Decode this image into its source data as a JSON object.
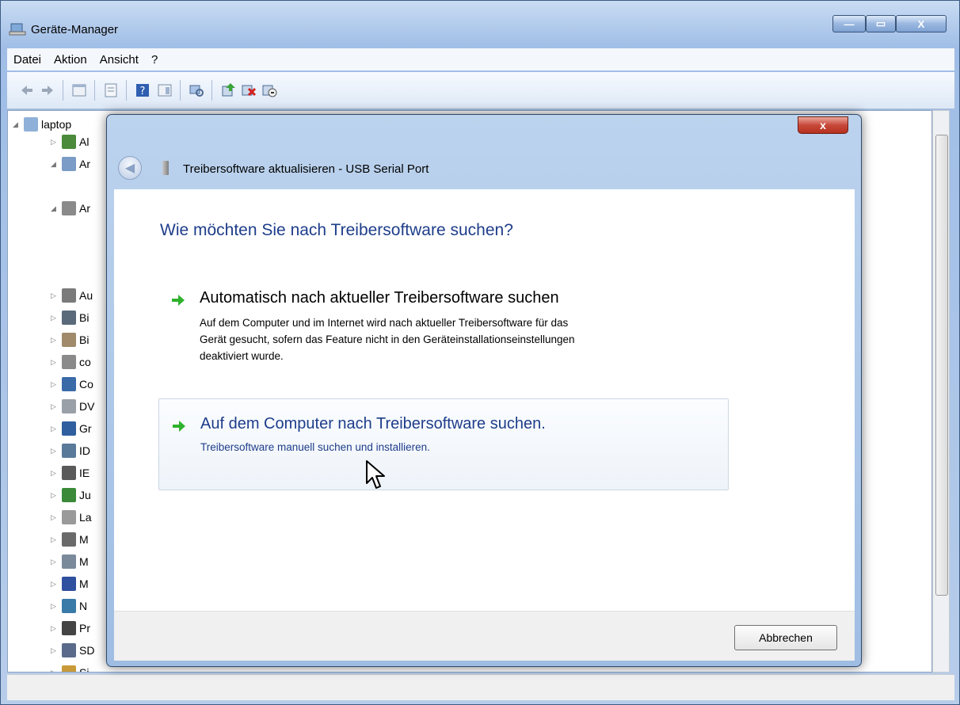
{
  "window": {
    "title": "Geräte-Manager",
    "min_glyph": "—",
    "max_glyph": "▭",
    "close_glyph": "X"
  },
  "menu": [
    "Datei",
    "Aktion",
    "Ansicht",
    "?"
  ],
  "tree": {
    "root": "laptop",
    "items": [
      "Al",
      "Ar",
      "Ar",
      "Au",
      "Bi",
      "Bi",
      "co",
      "Co",
      "DV",
      "Gr",
      "ID",
      "IE",
      "Ju",
      "La",
      "M",
      "M",
      "M",
      "N",
      "Pr",
      "SD",
      "Si"
    ]
  },
  "wizard": {
    "title": "Treibersoftware aktualisieren - USB Serial Port",
    "close_glyph": "x",
    "heading": "Wie möchten Sie nach Treibersoftware suchen?",
    "option_auto": {
      "title": "Automatisch nach aktueller Treibersoftware suchen",
      "desc_lines": [
        "Auf dem Computer und im Internet wird nach aktueller Treibersoftware für das",
        "Gerät gesucht, sofern das Feature nicht in den Geräteinstallationseinstellungen",
        "deaktiviert wurde."
      ]
    },
    "option_manual": {
      "title": "Auf dem Computer nach Treibersoftware suchen.",
      "desc": "Treibersoftware manuell suchen und installieren."
    },
    "cancel_label": "Abbrechen"
  },
  "icons": {
    "app": "device-manager-icon",
    "back": "back-arrow-icon",
    "option_arrow": "green-arrow-icon",
    "cursor": "mouse-pointer-icon"
  },
  "colors": {
    "heading": "#1e3d8a",
    "option_arrow": "#2fb12c",
    "close_button": "#c7493a"
  }
}
